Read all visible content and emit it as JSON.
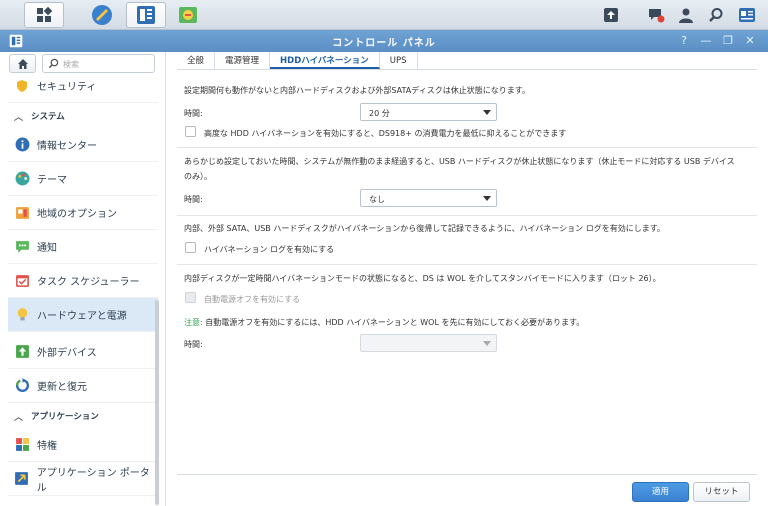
{
  "window": {
    "title": "コントロール パネル"
  },
  "sidebar": {
    "search_placeholder": "検索",
    "items_top": [
      {
        "label": "セキュリティ",
        "icon": "shield-icon"
      }
    ],
    "group_system": "システム",
    "items_system": [
      {
        "label": "情報センター",
        "icon": "info-icon"
      },
      {
        "label": "テーマ",
        "icon": "palette-icon"
      },
      {
        "label": "地域のオプション",
        "icon": "region-icon"
      },
      {
        "label": "通知",
        "icon": "notification-icon"
      },
      {
        "label": "タスク スケジューラー",
        "icon": "calendar-icon"
      },
      {
        "label": "ハードウェアと電源",
        "icon": "bulb-icon"
      },
      {
        "label": "外部デバイス",
        "icon": "external-device-icon"
      },
      {
        "label": "更新と復元",
        "icon": "refresh-icon"
      }
    ],
    "group_apps": "アプリケーション",
    "items_apps": [
      {
        "label": "特権",
        "icon": "privileges-icon"
      },
      {
        "label": "アプリケーション ポータル",
        "icon": "portal-icon"
      }
    ],
    "selected": "ハードウェアと電源"
  },
  "tabs": [
    "全般",
    "電源管理",
    "HDDハイバネーション",
    "UPS"
  ],
  "active_tab": "HDDハイバネーション",
  "section1": {
    "desc": "設定期間何も動作がないと内部ハードディスクおよび外部SATAディスクは休止状態になります。",
    "time_label": "時間:",
    "time_value": "20 分",
    "checkbox_label": "高度な HDD ハイバネーションを有効にすると、DS918+ の消費電力を最低に抑えることができます"
  },
  "section2": {
    "desc_line1": "あらかじめ設定しておいた時間、システムが無作動のまま経過すると、USB ハードディスクが休止状態になります（休止モードに対応する USB デバイス",
    "desc_line2": "のみ）。",
    "time_label": "時間:",
    "time_value": "なし"
  },
  "section3": {
    "desc": "内部、外部 SATA、USB ハードディスクがハイバネーションから復帰して記録できるように、ハイバネーション ログを有効にします。",
    "checkbox_label": "ハイバネーション ログを有効にする"
  },
  "section4": {
    "desc": "内部ディスクが一定時間ハイバネーションモードの状態になると、DS は WOL を介してスタンバイモードに入ります（ロット 26）。",
    "checkbox_label": "自動電源オフを有効にする",
    "note_prefix": "注意:",
    "note_text": " 自動電源オフを有効にするには、HDD ハイバネーションと WOL を先に有効にしておく必要があります。",
    "time_label": "時間:"
  },
  "buttons": {
    "apply": "適用",
    "reset": "リセット"
  },
  "colors": {
    "accent": "#3a82d1",
    "title_bar": "#5b8fc4",
    "selected_item": "#dbe9f6",
    "note": "#2f9d4a"
  }
}
